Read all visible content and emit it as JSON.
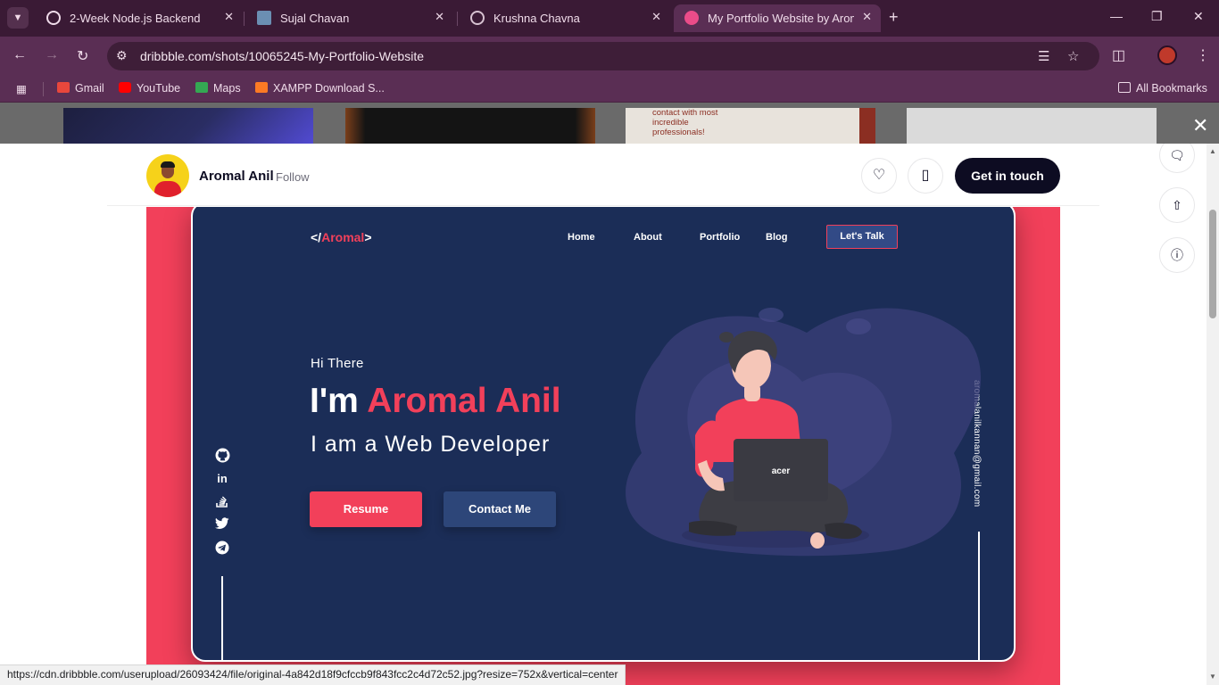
{
  "browser": {
    "tabs": [
      {
        "title": "2-Week Node.js Backend",
        "icon": "openai-icon"
      },
      {
        "title": "Sujal Chavan",
        "icon": "profile-photo-icon"
      },
      {
        "title": "Krushna Chavna",
        "icon": "globe-icon"
      },
      {
        "title": "My Portfolio Website by Aromal",
        "icon": "dribbble-icon"
      }
    ],
    "address": "dribbble.com/shots/10065245-My-Portfolio-Website",
    "bookmarks": [
      {
        "label": "Gmail",
        "icon": "gmail-icon"
      },
      {
        "label": "YouTube",
        "icon": "youtube-icon"
      },
      {
        "label": "Maps",
        "icon": "maps-icon"
      },
      {
        "label": "XAMPP Download S...",
        "icon": "xampp-icon"
      }
    ],
    "all_bookmarks": "All Bookmarks",
    "status_url": "https://cdn.dribbble.com/userupload/26093424/file/original-4a842d18f9cfccb9f843fcc2c4d72c52.jpg?resize=752x&vertical=center"
  },
  "backdrop": {
    "thumb3_text": "contact with most incredible professionals!"
  },
  "shot_header": {
    "author": "Aromal Anil",
    "follow": "Follow",
    "cta": "Get in touch"
  },
  "portfolio": {
    "logo_prefix": "</",
    "logo_name": "Aromal",
    "logo_suffix": ">",
    "nav": [
      "Home",
      "About",
      "Portfolio",
      "Blog"
    ],
    "talk": "Let's Talk",
    "greeting": "Hi There",
    "headline_prefix": "I'm ",
    "headline_name": "Aromal Anil",
    "role": "I am a Web Developer",
    "resume": "Resume",
    "contact": "Contact Me",
    "email": "aromalanilkannan@gmail.com",
    "laptop_brand": "acer",
    "social": [
      "github-icon",
      "linkedin-icon",
      "stackoverflow-icon",
      "twitter-icon",
      "telegram-icon"
    ]
  },
  "colors": {
    "accent": "#f2405a",
    "navy": "#1b2d57",
    "chrome": "#5a2e54"
  }
}
